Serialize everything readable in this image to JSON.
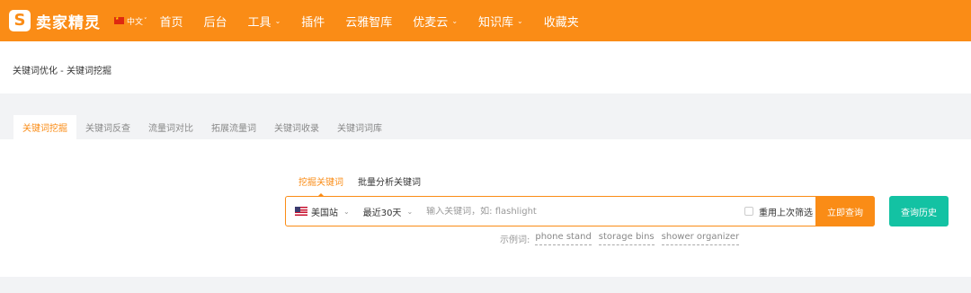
{
  "header": {
    "logo_text": "卖家精灵",
    "logo_icon": "s-logo-icon",
    "language": "中文",
    "nav": [
      {
        "label": "首页",
        "has_dropdown": false
      },
      {
        "label": "后台",
        "has_dropdown": false
      },
      {
        "label": "工具",
        "has_dropdown": true
      },
      {
        "label": "插件",
        "has_dropdown": false
      },
      {
        "label": "云雅智库",
        "has_dropdown": false
      },
      {
        "label": "优麦云",
        "has_dropdown": true
      },
      {
        "label": "知识库",
        "has_dropdown": true
      },
      {
        "label": "收藏夹",
        "has_dropdown": false
      }
    ],
    "brand_color": "#fa8c16"
  },
  "breadcrumb": "关键词优化 - 关键词挖掘",
  "tabs": [
    {
      "label": "关键词挖掘",
      "active": true
    },
    {
      "label": "关键词反查",
      "active": false
    },
    {
      "label": "流量词对比",
      "active": false
    },
    {
      "label": "拓展流量词",
      "active": false
    },
    {
      "label": "关键词收录",
      "active": false
    },
    {
      "label": "关键词词库",
      "active": false
    }
  ],
  "search": {
    "subtabs": [
      {
        "label": "挖掘关键词",
        "active": true
      },
      {
        "label": "批量分析关键词",
        "active": false
      }
    ],
    "site_label": "美国站",
    "site_flag": "us-flag-icon",
    "period_label": "最近30天",
    "placeholder": "输入关键词，如: flashlight",
    "value": "",
    "reuse_filter_label": "重用上次筛选",
    "reuse_filter_checked": false,
    "query_button": "立即查询",
    "history_button": "查询历史",
    "history_color": "#13c2a3",
    "examples_label": "示例词:",
    "examples": [
      "phone stand",
      "storage bins",
      "shower organizer"
    ]
  }
}
